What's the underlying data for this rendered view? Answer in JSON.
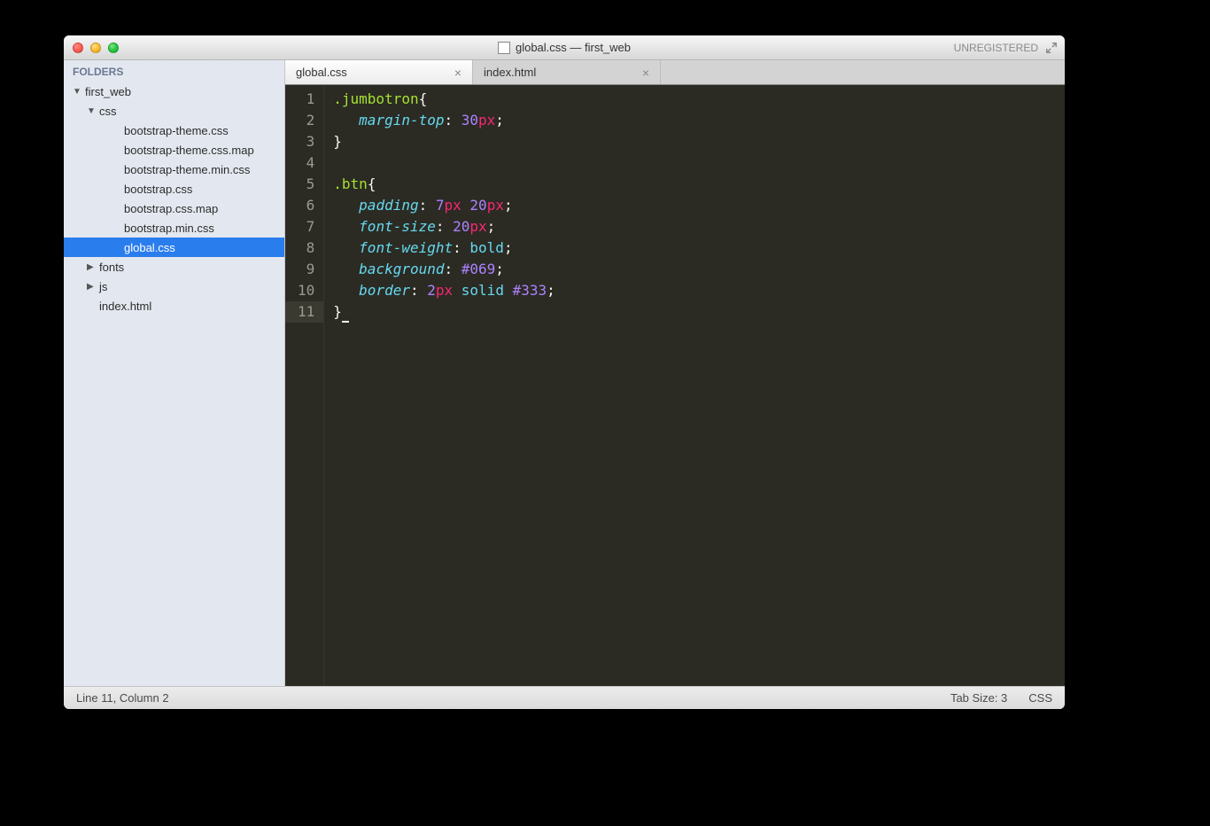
{
  "title": {
    "text": "global.css — first_web",
    "unregistered": "UNREGISTERED"
  },
  "sidebar": {
    "header": "FOLDERS",
    "items": [
      {
        "label": "first_web",
        "indent": 0,
        "disclosure": "▼"
      },
      {
        "label": "css",
        "indent": 1,
        "disclosure": "▼"
      },
      {
        "label": "bootstrap-theme.css",
        "indent": 2,
        "disclosure": ""
      },
      {
        "label": "bootstrap-theme.css.map",
        "indent": 2,
        "disclosure": ""
      },
      {
        "label": "bootstrap-theme.min.css",
        "indent": 2,
        "disclosure": ""
      },
      {
        "label": "bootstrap.css",
        "indent": 2,
        "disclosure": ""
      },
      {
        "label": "bootstrap.css.map",
        "indent": 2,
        "disclosure": ""
      },
      {
        "label": "bootstrap.min.css",
        "indent": 2,
        "disclosure": ""
      },
      {
        "label": "global.css",
        "indent": 2,
        "disclosure": "",
        "selected": true
      },
      {
        "label": "fonts",
        "indent": 1,
        "disclosure": "▶"
      },
      {
        "label": "js",
        "indent": 1,
        "disclosure": "▶"
      },
      {
        "label": "index.html",
        "indent": 1,
        "disclosure": ""
      }
    ]
  },
  "tabs": [
    {
      "label": "global.css",
      "active": true
    },
    {
      "label": "index.html",
      "active": false
    }
  ],
  "code_lines": [
    [
      {
        "t": ".jumbotron",
        "c": "tok-sel"
      },
      {
        "t": "{",
        "c": "tok-punc"
      }
    ],
    [
      {
        "t": "   ",
        "c": ""
      },
      {
        "t": "margin-top",
        "c": "tok-prop"
      },
      {
        "t": ": ",
        "c": "tok-punc"
      },
      {
        "t": "30",
        "c": "tok-num"
      },
      {
        "t": "px",
        "c": "tok-unit"
      },
      {
        "t": ";",
        "c": "tok-punc"
      }
    ],
    [
      {
        "t": "}",
        "c": "tok-punc"
      }
    ],
    [],
    [
      {
        "t": ".btn",
        "c": "tok-sel"
      },
      {
        "t": "{",
        "c": "tok-punc"
      }
    ],
    [
      {
        "t": "   ",
        "c": ""
      },
      {
        "t": "padding",
        "c": "tok-prop"
      },
      {
        "t": ": ",
        "c": "tok-punc"
      },
      {
        "t": "7",
        "c": "tok-num"
      },
      {
        "t": "px",
        "c": "tok-unit"
      },
      {
        "t": " ",
        "c": ""
      },
      {
        "t": "20",
        "c": "tok-num"
      },
      {
        "t": "px",
        "c": "tok-unit"
      },
      {
        "t": ";",
        "c": "tok-punc"
      }
    ],
    [
      {
        "t": "   ",
        "c": ""
      },
      {
        "t": "font-size",
        "c": "tok-prop"
      },
      {
        "t": ": ",
        "c": "tok-punc"
      },
      {
        "t": "20",
        "c": "tok-num"
      },
      {
        "t": "px",
        "c": "tok-unit"
      },
      {
        "t": ";",
        "c": "tok-punc"
      }
    ],
    [
      {
        "t": "   ",
        "c": ""
      },
      {
        "t": "font-weight",
        "c": "tok-prop"
      },
      {
        "t": ": ",
        "c": "tok-punc"
      },
      {
        "t": "bold",
        "c": "tok-val"
      },
      {
        "t": ";",
        "c": "tok-punc"
      }
    ],
    [
      {
        "t": "   ",
        "c": ""
      },
      {
        "t": "background",
        "c": "tok-prop"
      },
      {
        "t": ": ",
        "c": "tok-punc"
      },
      {
        "t": "#069",
        "c": "tok-hex"
      },
      {
        "t": ";",
        "c": "tok-punc"
      }
    ],
    [
      {
        "t": "   ",
        "c": ""
      },
      {
        "t": "border",
        "c": "tok-prop"
      },
      {
        "t": ": ",
        "c": "tok-punc"
      },
      {
        "t": "2",
        "c": "tok-num"
      },
      {
        "t": "px",
        "c": "tok-unit"
      },
      {
        "t": " ",
        "c": ""
      },
      {
        "t": "solid",
        "c": "tok-val"
      },
      {
        "t": " ",
        "c": ""
      },
      {
        "t": "#333",
        "c": "tok-hex"
      },
      {
        "t": ";",
        "c": "tok-punc"
      }
    ],
    [
      {
        "t": "}",
        "c": "tok-punc"
      },
      {
        "t": "",
        "c": "",
        "cursor": true
      }
    ]
  ],
  "status": {
    "position": "Line 11, Column 2",
    "tab_size": "Tab Size: 3",
    "syntax": "CSS"
  }
}
